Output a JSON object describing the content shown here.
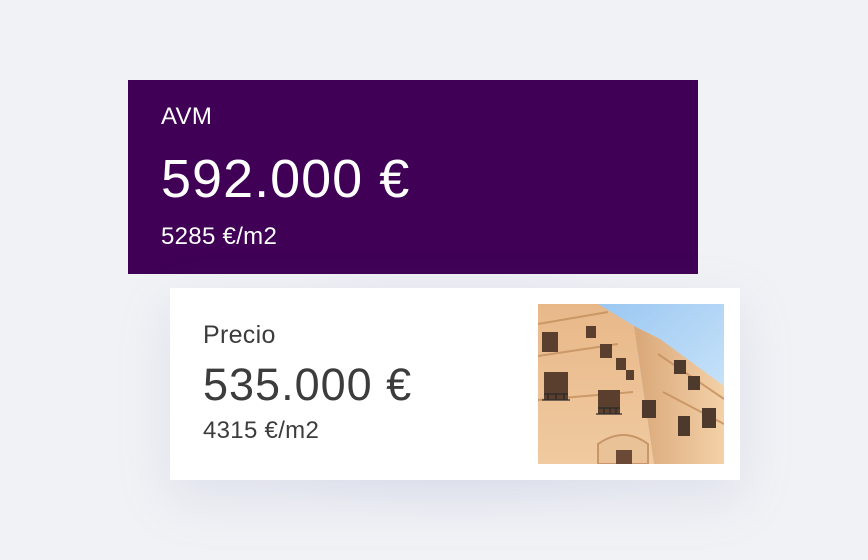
{
  "avm": {
    "label": "AVM",
    "value": "592.000 €",
    "price_per_sqm": "5285 €/m2"
  },
  "listing": {
    "label": "Precio",
    "value": "535.000 €",
    "price_per_sqm": "4315 €/m2"
  },
  "colors": {
    "avm_background": "#3f0056",
    "page_background": "#f1f2f6",
    "listing_text": "#3c3c3c"
  },
  "icons": {
    "listing_photo": "building-photo"
  }
}
